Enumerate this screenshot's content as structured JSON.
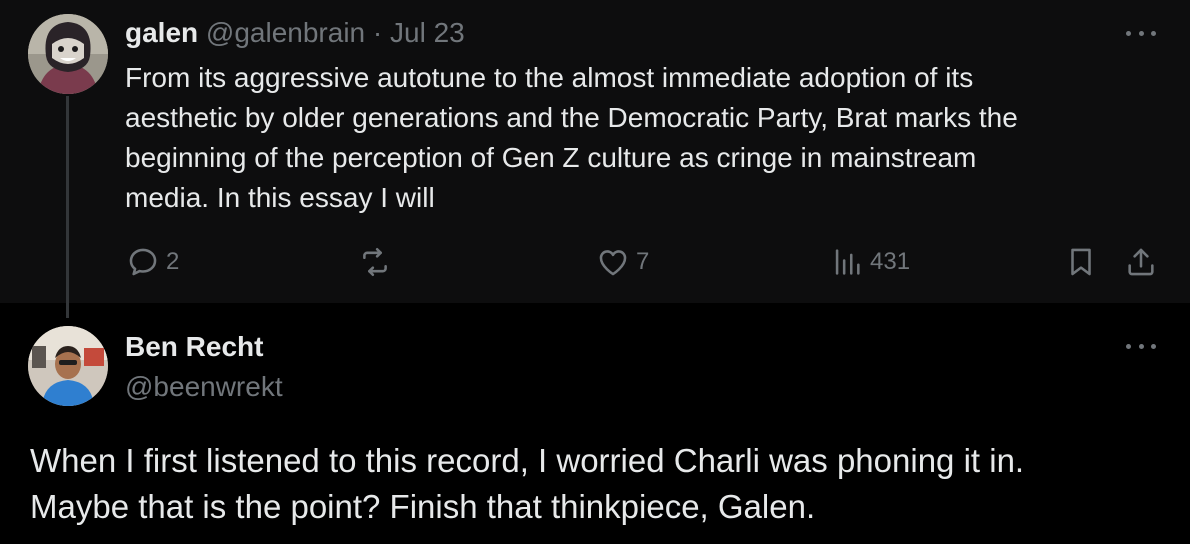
{
  "parent_tweet": {
    "author_name": "galen",
    "author_handle": "@galenbrain",
    "separator": "·",
    "date": "Jul 23",
    "text_lines": [
      "From its aggressive autotune to the almost immediate adoption of its",
      "aesthetic by older generations and the Democratic Party, Brat marks the",
      "beginning of the perception of Gen Z culture as cringe in mainstream",
      "media. In this essay I will"
    ],
    "actions": {
      "reply_count": "2",
      "retweet_count": "",
      "like_count": "7",
      "view_count": "431"
    },
    "icons": [
      "reply-icon",
      "retweet-icon",
      "like-icon",
      "views-icon",
      "bookmark-icon",
      "share-icon",
      "more-icon"
    ]
  },
  "reply_tweet": {
    "author_name": "Ben Recht",
    "author_handle": "@beenwrekt",
    "text_lines": [
      "When I first listened to this record, I worried Charli was phoning it in.",
      "Maybe that is the point? Finish that thinkpiece, Galen."
    ]
  },
  "colors": {
    "background": "#000000",
    "parent_background": "#0d0d0e",
    "text": "#e7e9ea",
    "muted": "#71767b"
  }
}
